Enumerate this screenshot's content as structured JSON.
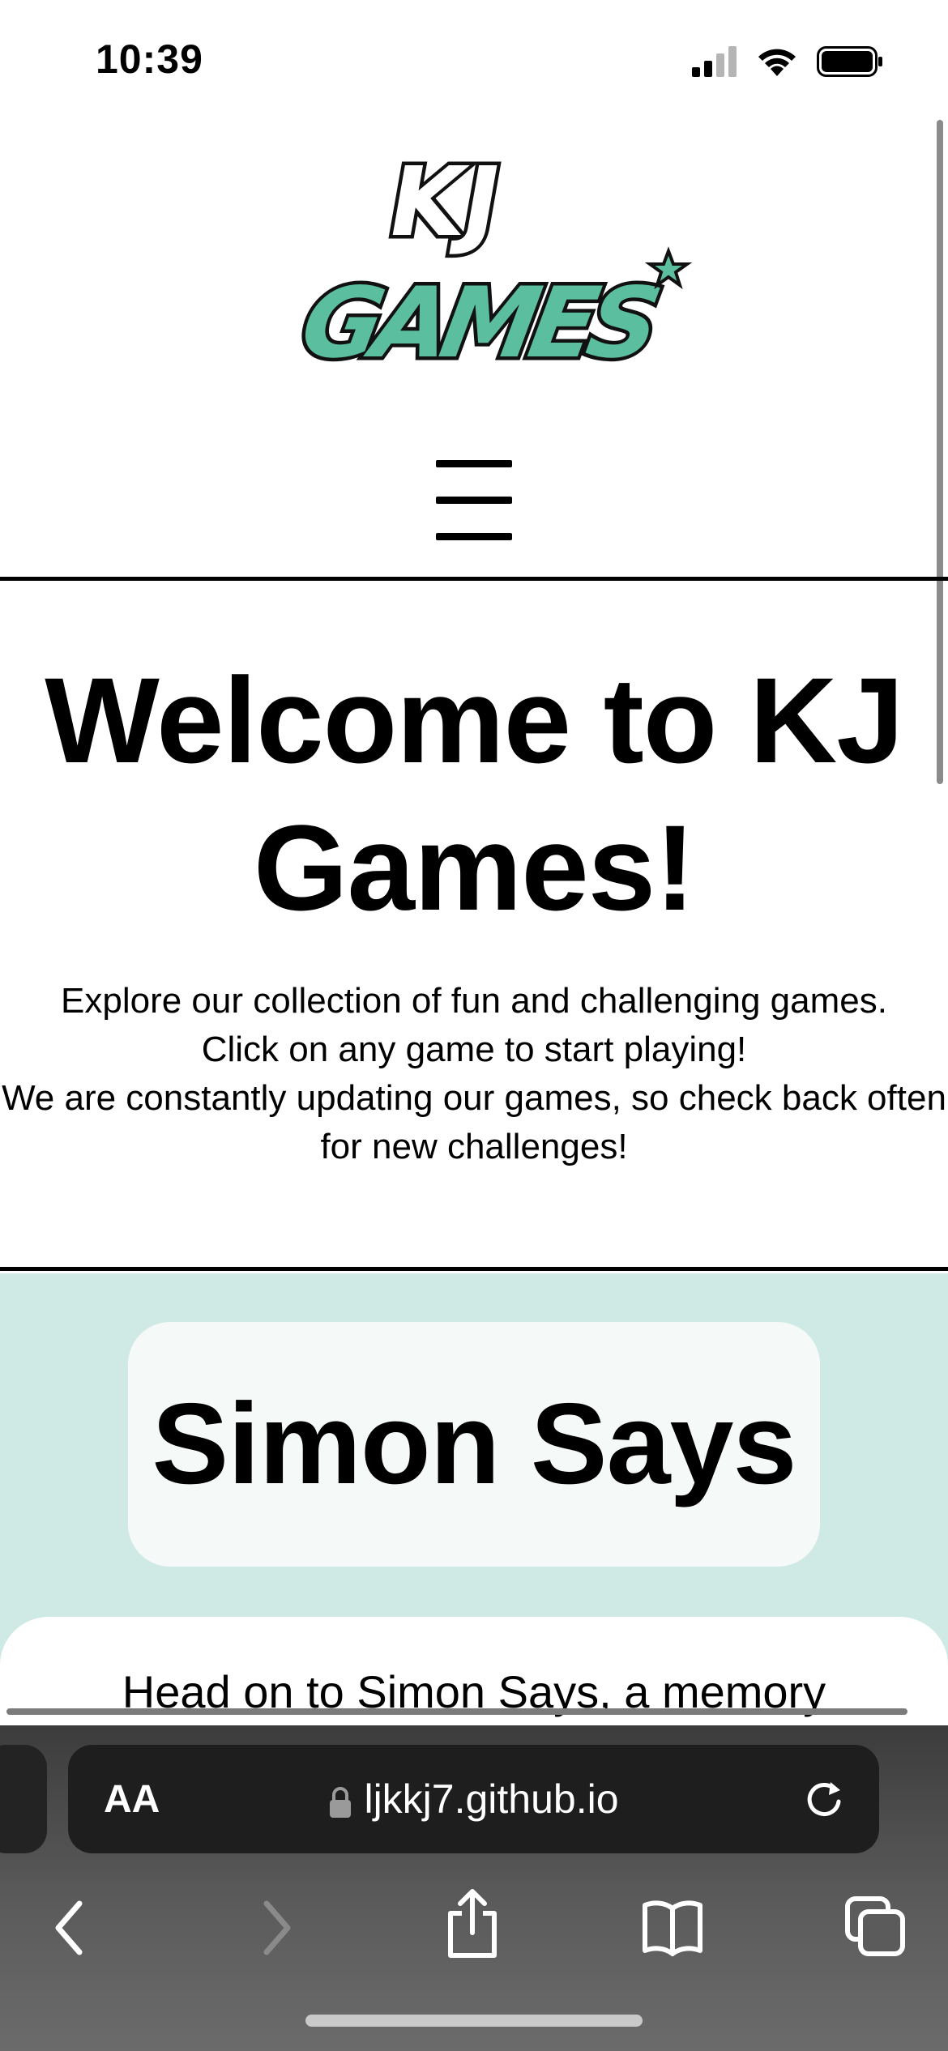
{
  "status_bar": {
    "time": "10:39"
  },
  "header": {
    "logo_top_text": "KJ",
    "logo_bottom_text": "GAMES",
    "menu_icon": "hamburger-menu-icon"
  },
  "welcome": {
    "title": "Welcome to KJ Games!",
    "paragraph_line1": "Explore our collection of fun and challenging games.",
    "paragraph_line2": "Click on any game to start playing!",
    "paragraph_line3": "We are constantly updating our games, so check back often for new challenges!"
  },
  "game": {
    "title": "Simon Says",
    "description": "Head on to Simon Says, a memory"
  },
  "browser": {
    "text_size_label": "AA",
    "url": "ljkkj7.github.io"
  },
  "colors": {
    "accent": "#5bbf9f",
    "section_bg": "#cfeae4"
  }
}
